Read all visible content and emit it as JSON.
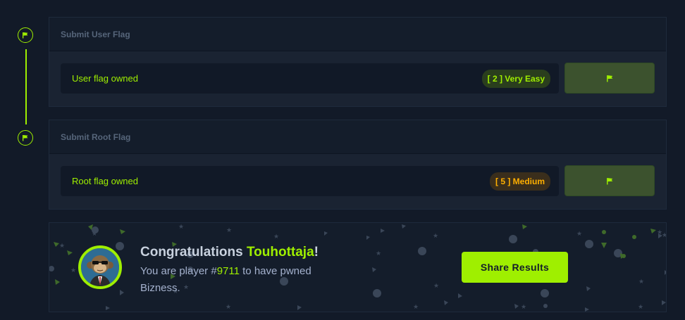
{
  "user_flag": {
    "header": "Submit User Flag",
    "status": "User flag owned",
    "difficulty": "[ 2 ] Very Easy"
  },
  "root_flag": {
    "header": "Submit Root Flag",
    "status": "Root flag owned",
    "difficulty": "[ 5 ] Medium"
  },
  "congrats": {
    "title_prefix": "Congratulations ",
    "player_name": "Touhottaja",
    "title_suffix": "!",
    "line_prefix": "You are player #",
    "player_number": "9711",
    "line_suffix": " to have pwned Bizness.",
    "share_label": "Share Results"
  },
  "colors": {
    "accent": "#9fef00",
    "medium": "#ffaf00",
    "background": "#121a28"
  },
  "icons": {
    "step": "flag-icon",
    "submit": "flag-icon"
  }
}
